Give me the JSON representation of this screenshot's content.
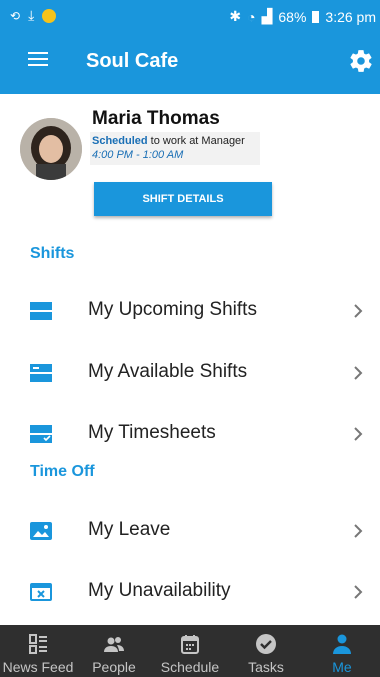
{
  "status_bar": {
    "battery": "68%",
    "time": "3:26 pm"
  },
  "app_bar": {
    "title": "Soul Cafe"
  },
  "profile": {
    "name": "Maria Thomas",
    "scheduled_keyword": "Scheduled",
    "scheduled_rest": " to work at Manager",
    "time_range": "4:00 PM - 1:00 AM",
    "button_label": "SHIFT DETAILS"
  },
  "shifts_section": {
    "title": "Shifts",
    "items": [
      {
        "label": "My Upcoming Shifts",
        "icon": "upcoming-shifts-icon"
      },
      {
        "label": "My Available Shifts",
        "icon": "available-shifts-icon"
      },
      {
        "label": "My Timesheets",
        "icon": "timesheets-icon"
      }
    ]
  },
  "time_off_section": {
    "title": "Time Off",
    "items": [
      {
        "label": "My Leave",
        "icon": "leave-icon"
      },
      {
        "label": "My Unavailability",
        "icon": "unavailability-icon"
      }
    ]
  },
  "bottom_nav": {
    "items": [
      {
        "label": "News Feed",
        "icon": "news-feed-icon",
        "active": false
      },
      {
        "label": "People",
        "icon": "people-icon",
        "active": false
      },
      {
        "label": "Schedule",
        "icon": "calendar-icon",
        "active": false
      },
      {
        "label": "Tasks",
        "icon": "check-circle-icon",
        "active": false
      },
      {
        "label": "Me",
        "icon": "person-icon",
        "active": true
      }
    ]
  },
  "colors": {
    "accent": "#1a96dc",
    "nav_background": "#2f2f2f",
    "nav_inactive": "#c5c5c5"
  }
}
